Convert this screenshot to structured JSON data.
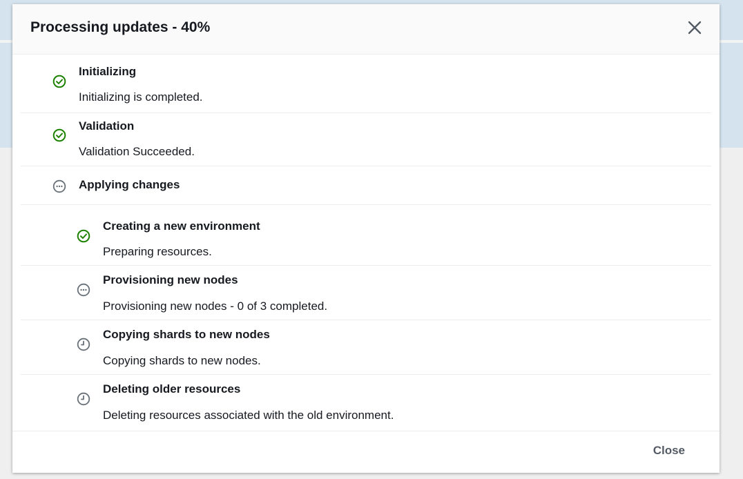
{
  "modal": {
    "title": "Processing updates - 40%",
    "progress_percent": 40,
    "close_button_label": "Close",
    "steps": [
      {
        "title": "Initializing",
        "description": "Initializing is completed.",
        "status": "completed",
        "icon": "check-circle-icon"
      },
      {
        "title": "Validation",
        "description": "Validation Succeeded.",
        "status": "completed",
        "icon": "check-circle-icon"
      },
      {
        "title": "Applying changes",
        "description": "",
        "status": "in-progress",
        "icon": "ellipsis-circle-icon"
      }
    ],
    "substeps": [
      {
        "title": "Creating a new environment",
        "description": "Preparing resources.",
        "status": "completed",
        "icon": "check-circle-icon"
      },
      {
        "title": "Provisioning new nodes",
        "description": "Provisioning new nodes - 0 of 3 completed.",
        "status": "in-progress",
        "icon": "ellipsis-circle-icon"
      },
      {
        "title": "Copying shards to new nodes",
        "description": "Copying shards to new nodes.",
        "status": "pending",
        "icon": "clock-icon"
      },
      {
        "title": "Deleting older resources",
        "description": "Deleting resources associated with the old environment.",
        "status": "pending",
        "icon": "clock-icon"
      }
    ]
  },
  "colors": {
    "success": "#1d8102",
    "neutral": "#687078",
    "text": "#16191f",
    "footer_button": "#545b64"
  }
}
